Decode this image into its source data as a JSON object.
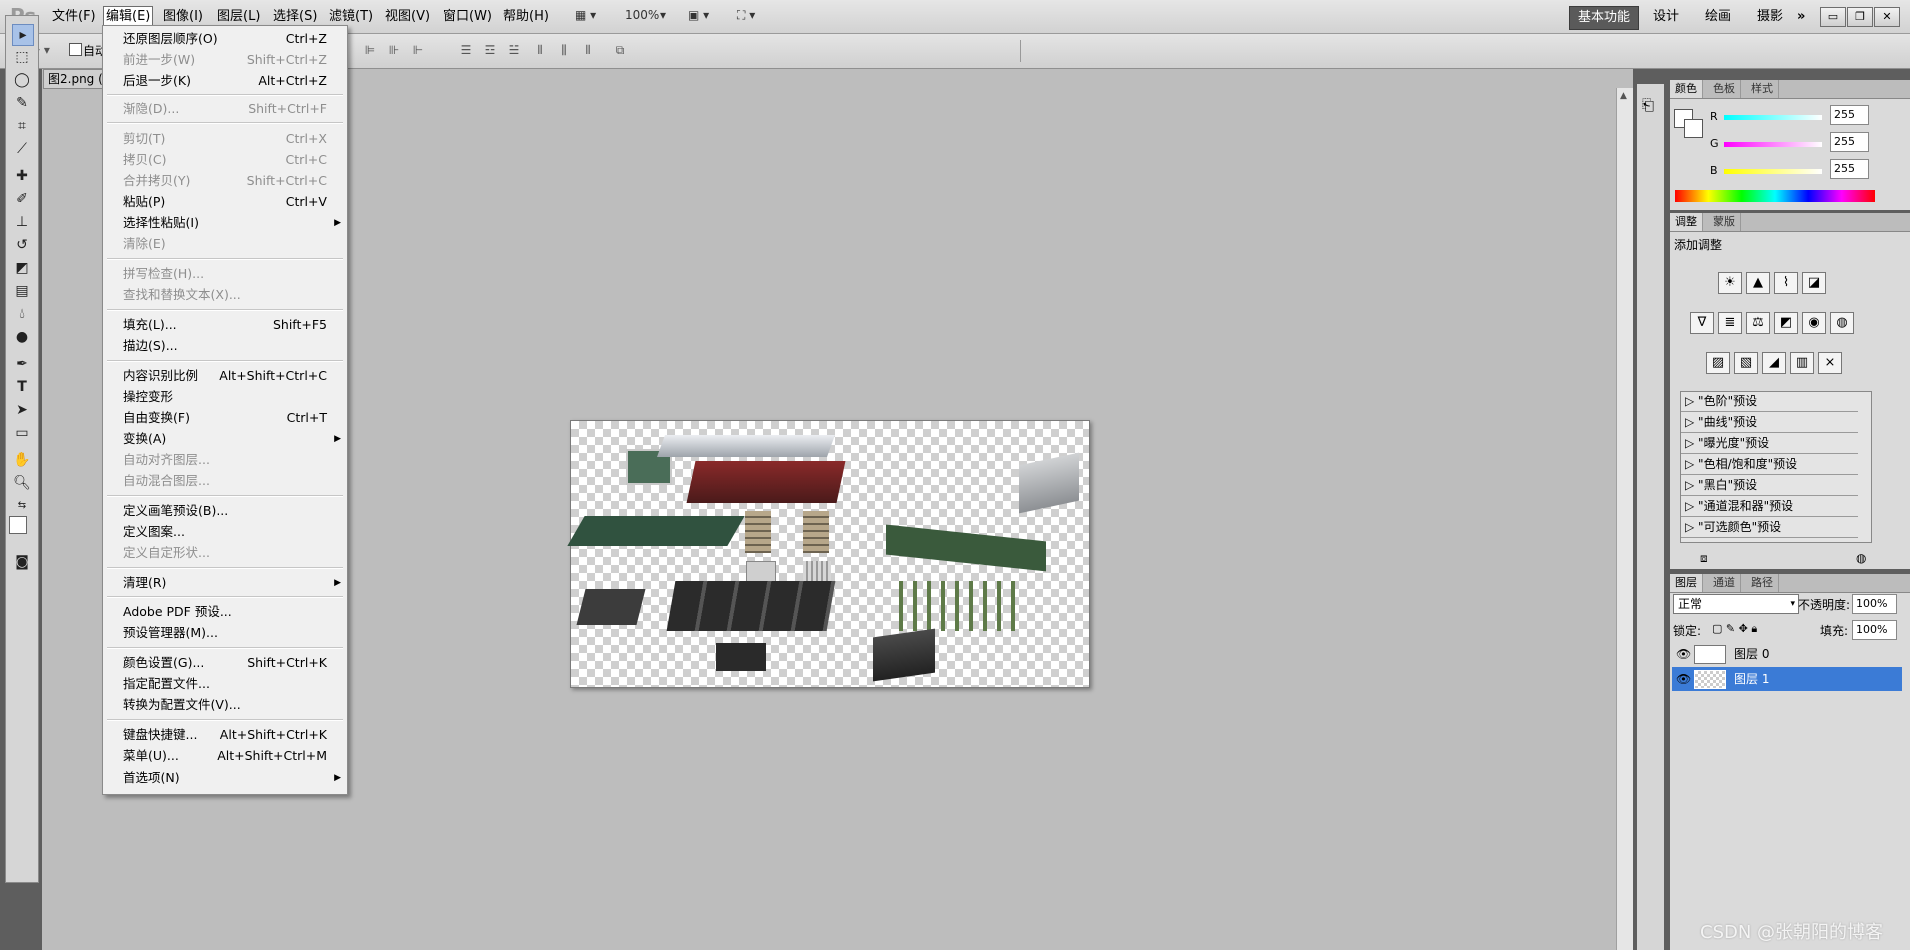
{
  "app": {
    "logo": "Ps"
  },
  "menubar": {
    "items": [
      "文件(F)",
      "编辑(E)",
      "图像(I)",
      "图层(L)",
      "选择(S)",
      "滤镜(T)",
      "视图(V)",
      "窗口(W)",
      "帮助(H)"
    ],
    "zoom": "100%",
    "workspaces": [
      "基本功能",
      "设计",
      "绘画",
      "摄影"
    ],
    "more": "»"
  },
  "optionsbar": {
    "auto_select": "自动"
  },
  "document": {
    "tab_title": "图2.png ("
  },
  "edit_menu": {
    "items": [
      {
        "label": "还原图层顺序(O)",
        "shortcut": "Ctrl+Z",
        "disabled": false
      },
      {
        "label": "前进一步(W)",
        "shortcut": "Shift+Ctrl+Z",
        "disabled": true
      },
      {
        "label": "后退一步(K)",
        "shortcut": "Alt+Ctrl+Z",
        "disabled": false
      },
      {
        "label": "渐隐(D)...",
        "shortcut": "Shift+Ctrl+F",
        "disabled": true
      },
      {
        "label": "剪切(T)",
        "shortcut": "Ctrl+X",
        "disabled": true
      },
      {
        "label": "拷贝(C)",
        "shortcut": "Ctrl+C",
        "disabled": true
      },
      {
        "label": "合并拷贝(Y)",
        "shortcut": "Shift+Ctrl+C",
        "disabled": true
      },
      {
        "label": "粘贴(P)",
        "shortcut": "Ctrl+V",
        "disabled": false
      },
      {
        "label": "选择性粘贴(I)",
        "shortcut": "",
        "disabled": false,
        "submenu": true
      },
      {
        "label": "清除(E)",
        "shortcut": "",
        "disabled": true
      },
      {
        "label": "拼写检查(H)...",
        "shortcut": "",
        "disabled": true
      },
      {
        "label": "查找和替换文本(X)...",
        "shortcut": "",
        "disabled": true
      },
      {
        "label": "填充(L)...",
        "shortcut": "Shift+F5",
        "disabled": false
      },
      {
        "label": "描边(S)...",
        "shortcut": "",
        "disabled": false
      },
      {
        "label": "内容识别比例",
        "shortcut": "Alt+Shift+Ctrl+C",
        "disabled": false
      },
      {
        "label": "操控变形",
        "shortcut": "",
        "disabled": false
      },
      {
        "label": "自由变换(F)",
        "shortcut": "Ctrl+T",
        "disabled": false
      },
      {
        "label": "变换(A)",
        "shortcut": "",
        "disabled": false,
        "submenu": true
      },
      {
        "label": "自动对齐图层...",
        "shortcut": "",
        "disabled": true
      },
      {
        "label": "自动混合图层...",
        "shortcut": "",
        "disabled": true
      },
      {
        "label": "定义画笔预设(B)...",
        "shortcut": "",
        "disabled": false
      },
      {
        "label": "定义图案...",
        "shortcut": "",
        "disabled": false
      },
      {
        "label": "定义自定形状...",
        "shortcut": "",
        "disabled": true
      },
      {
        "label": "清理(R)",
        "shortcut": "",
        "disabled": false,
        "submenu": true
      },
      {
        "label": "Adobe PDF 预设...",
        "shortcut": "",
        "disabled": false
      },
      {
        "label": "预设管理器(M)...",
        "shortcut": "",
        "disabled": false
      },
      {
        "label": "颜色设置(G)...",
        "shortcut": "Shift+Ctrl+K",
        "disabled": false
      },
      {
        "label": "指定配置文件...",
        "shortcut": "",
        "disabled": false
      },
      {
        "label": "转换为配置文件(V)...",
        "shortcut": "",
        "disabled": false
      },
      {
        "label": "键盘快捷键...",
        "shortcut": "Alt+Shift+Ctrl+K",
        "disabled": false
      },
      {
        "label": "菜单(U)...",
        "shortcut": "Alt+Shift+Ctrl+M",
        "disabled": false
      },
      {
        "label": "首选项(N)",
        "shortcut": "",
        "disabled": false,
        "submenu": true
      }
    ]
  },
  "color_panel": {
    "tabs": [
      "颜色",
      "色板",
      "样式"
    ],
    "channels": [
      {
        "name": "R",
        "value": "255",
        "color": "#00e0e0"
      },
      {
        "name": "G",
        "value": "255",
        "color": "#e000e0"
      },
      {
        "name": "B",
        "value": "255",
        "color": "#e0e000"
      }
    ]
  },
  "adjust_panel": {
    "tabs": [
      "调整",
      "蒙版"
    ],
    "title": "添加调整",
    "presets": [
      "\"色阶\"预设",
      "\"曲线\"预设",
      "\"曝光度\"预设",
      "\"色相/饱和度\"预设",
      "\"黑白\"预设",
      "\"通道混和器\"预设",
      "\"可选颜色\"预设"
    ]
  },
  "layers_panel": {
    "tabs": [
      "图层",
      "通道",
      "路径"
    ],
    "blend_mode": "正常",
    "opacity_label": "不透明度:",
    "opacity": "100%",
    "lock_label": "锁定:",
    "fill_label": "填充:",
    "fill": "100%",
    "layers": [
      {
        "name": "图层 0",
        "selected": false
      },
      {
        "name": "图层 1",
        "selected": true
      }
    ]
  },
  "watermark": "CSDN @张朝阳的博客"
}
